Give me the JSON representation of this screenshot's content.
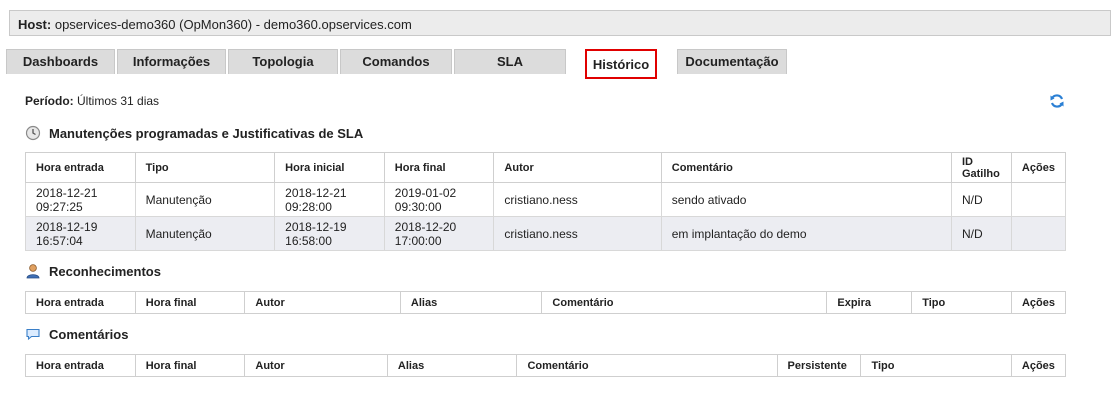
{
  "host": {
    "label": "Host:",
    "value": "opservices-demo360 (OpMon360) - demo360.opservices.com"
  },
  "tabs": [
    {
      "label": "Dashboards"
    },
    {
      "label": "Informações"
    },
    {
      "label": "Topologia"
    },
    {
      "label": "Comandos"
    },
    {
      "label": "SLA"
    },
    {
      "label": "Histórico",
      "active": true
    },
    {
      "label": "Documentação"
    }
  ],
  "periodo": {
    "label": "Período:",
    "value": "Últimos 31 dias"
  },
  "icons": {
    "refresh": "refresh-icon",
    "maintenance": "clock-icon",
    "acknowledgements": "user-icon",
    "comments": "speech-bubble-icon"
  },
  "colors": {
    "active_tab_border": "#e00000",
    "row_alt": "#ecedf2",
    "refresh_icon": "#2a7fd4"
  },
  "maintenance": {
    "title": "Manutenções programadas e Justificativas de SLA",
    "headers": [
      "Hora entrada",
      "Tipo",
      "Hora inicial",
      "Hora final",
      "Autor",
      "Comentário",
      "ID Gatilho",
      "Ações"
    ],
    "rows": [
      {
        "hora_entrada": "2018-12-21\n09:27:25",
        "tipo": "Manutenção",
        "hora_inicial": "2018-12-21\n09:28:00",
        "hora_final": "2019-01-02\n09:30:00",
        "autor": "cristiano.ness",
        "comentario": "sendo ativado",
        "id_gatilho": "N/D",
        "acoes": ""
      },
      {
        "hora_entrada": "2018-12-19\n16:57:04",
        "tipo": "Manutenção",
        "hora_inicial": "2018-12-19\n16:58:00",
        "hora_final": "2018-12-20\n17:00:00",
        "autor": "cristiano.ness",
        "comentario": "em implantação do demo",
        "id_gatilho": "N/D",
        "acoes": ""
      }
    ]
  },
  "acknowledgements": {
    "title": "Reconhecimentos",
    "headers": [
      "Hora entrada",
      "Hora final",
      "Autor",
      "Alias",
      "Comentário",
      "Expira",
      "Tipo",
      "Ações"
    ]
  },
  "comments": {
    "title": "Comentários",
    "headers": [
      "Hora entrada",
      "Hora final",
      "Autor",
      "Alias",
      "Comentário",
      "Persistente",
      "Tipo",
      "Ações"
    ]
  }
}
